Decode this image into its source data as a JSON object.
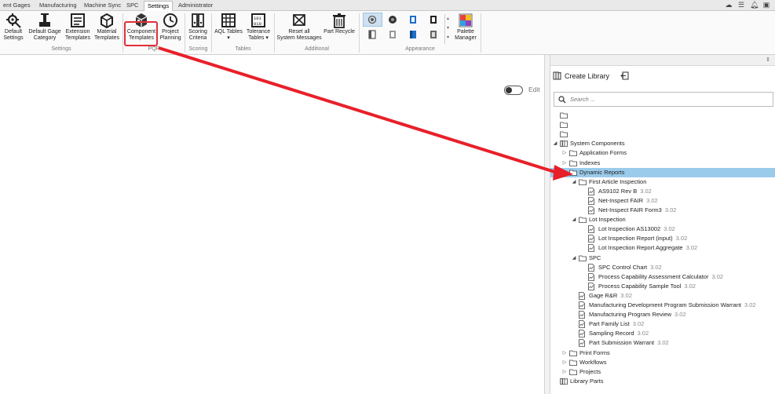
{
  "tabs": [
    {
      "label": "ent Gages",
      "active": false
    },
    {
      "label": "Manufacturing",
      "active": false
    },
    {
      "label": "Machine Sync",
      "active": false
    },
    {
      "label": "SPC",
      "active": false
    },
    {
      "label": "Settings",
      "active": true
    },
    {
      "label": "Administrator",
      "active": false
    }
  ],
  "ribbon": {
    "buttons": [
      {
        "line1": "Default",
        "line2": "Settings",
        "icon": "gear-settings-icon"
      },
      {
        "line1": "Default Gage",
        "line2": "Category",
        "icon": "gage-category-icon"
      },
      {
        "line1": "Extension",
        "line2": "Templates",
        "icon": "extension-templates-icon"
      },
      {
        "line1": "Material",
        "line2": "Templates",
        "icon": "material-templates-icon"
      },
      {
        "line1": "Component",
        "line2": "Templates",
        "icon": "component-templates-icon"
      },
      {
        "line1": "Project",
        "line2": "Planning",
        "icon": "clock-icon"
      },
      {
        "line1": "Scoring",
        "line2": "Criteria",
        "icon": "binders-icon"
      },
      {
        "line1": "AQL Tables",
        "line2": "▾",
        "icon": "table-grid-icon"
      },
      {
        "line1": "Tolerance",
        "line2": "Tables ▾",
        "icon": "tolerance-table-icon"
      },
      {
        "line1": "Reset all",
        "line2": "System Messages",
        "icon": "reset-messages-icon"
      },
      {
        "line1": "Part Recycle",
        "line2": "",
        "icon": "recycle-bin-icon"
      },
      {
        "line1": "Palette",
        "line2": "Manager",
        "icon": "palette-icon"
      }
    ],
    "groups": [
      "Settings",
      "PQP",
      "Scoring",
      "Tables",
      "Additional",
      "Appearance"
    ]
  },
  "edit": {
    "label": "Edit",
    "on": false
  },
  "library": {
    "create_label": "Create Library",
    "search_placeholder": "Search ..."
  },
  "tree": [
    {
      "label": "",
      "version": "",
      "depth": 0,
      "arrow": "",
      "icon": "folder"
    },
    {
      "label": "",
      "version": "",
      "depth": 0,
      "arrow": "",
      "icon": "folder"
    },
    {
      "label": "",
      "version": "",
      "depth": 0,
      "arrow": "",
      "icon": "folder"
    },
    {
      "label": "System Components",
      "version": "",
      "depth": 0,
      "arrow": "open",
      "icon": "library"
    },
    {
      "label": "Application Forms",
      "version": "",
      "depth": 1,
      "arrow": "closed",
      "icon": "folder"
    },
    {
      "label": "Indexes",
      "version": "",
      "depth": 1,
      "arrow": "closed",
      "icon": "folder"
    },
    {
      "label": "Dynamic Reports",
      "version": "",
      "depth": 1,
      "arrow": "open",
      "icon": "folder",
      "selected": true
    },
    {
      "label": "First Article Inspection",
      "version": "",
      "depth": 2,
      "arrow": "open",
      "icon": "folder"
    },
    {
      "label": "AS9102 Rev B",
      "version": "3.02",
      "depth": 3,
      "arrow": "",
      "icon": "doc"
    },
    {
      "label": "Net-Inspect FAIR",
      "version": "3.02",
      "depth": 3,
      "arrow": "",
      "icon": "doc"
    },
    {
      "label": "Net-Inspect FAIR Form3",
      "version": "3.02",
      "depth": 3,
      "arrow": "",
      "icon": "doc"
    },
    {
      "label": "Lot Inspection",
      "version": "",
      "depth": 2,
      "arrow": "open",
      "icon": "folder"
    },
    {
      "label": "Lot Inspection AS13002",
      "version": "3.02",
      "depth": 3,
      "arrow": "",
      "icon": "doc"
    },
    {
      "label": "Lot Inspection Report (input)",
      "version": "3.02",
      "depth": 3,
      "arrow": "",
      "icon": "doc"
    },
    {
      "label": "Lot Inspection Report Aggregate",
      "version": "3.02",
      "depth": 3,
      "arrow": "",
      "icon": "doc"
    },
    {
      "label": "SPC",
      "version": "",
      "depth": 2,
      "arrow": "open",
      "icon": "folder"
    },
    {
      "label": "SPC Control Chart",
      "version": "3.02",
      "depth": 3,
      "arrow": "",
      "icon": "doc"
    },
    {
      "label": "Process Capability Assessment Calculator",
      "version": "3.02",
      "depth": 3,
      "arrow": "",
      "icon": "doc"
    },
    {
      "label": "Process Capability Sample Tool",
      "version": "3.02",
      "depth": 3,
      "arrow": "",
      "icon": "doc"
    },
    {
      "label": "Gage R&R",
      "version": "3.02",
      "depth": 2,
      "arrow": "",
      "icon": "doc"
    },
    {
      "label": "Manufacturing Development Program Submission Warrant",
      "version": "3.02",
      "depth": 2,
      "arrow": "",
      "icon": "doc"
    },
    {
      "label": "Manufacturing Program Review",
      "version": "3.02",
      "depth": 2,
      "arrow": "",
      "icon": "doc"
    },
    {
      "label": "Part Family List",
      "version": "3.02",
      "depth": 2,
      "arrow": "",
      "icon": "doc"
    },
    {
      "label": "Sampling Record",
      "version": "3.02",
      "depth": 2,
      "arrow": "",
      "icon": "doc"
    },
    {
      "label": "Part Submission Warrant",
      "version": "3.02",
      "depth": 2,
      "arrow": "",
      "icon": "doc"
    },
    {
      "label": "Print Forms",
      "version": "",
      "depth": 1,
      "arrow": "closed",
      "icon": "folder"
    },
    {
      "label": "Workflows",
      "version": "",
      "depth": 1,
      "arrow": "closed",
      "icon": "folder"
    },
    {
      "label": "Projects",
      "version": "",
      "depth": 1,
      "arrow": "closed",
      "icon": "folder"
    },
    {
      "label": "Library Parts",
      "version": "",
      "depth": 0,
      "arrow": "",
      "icon": "library"
    }
  ]
}
